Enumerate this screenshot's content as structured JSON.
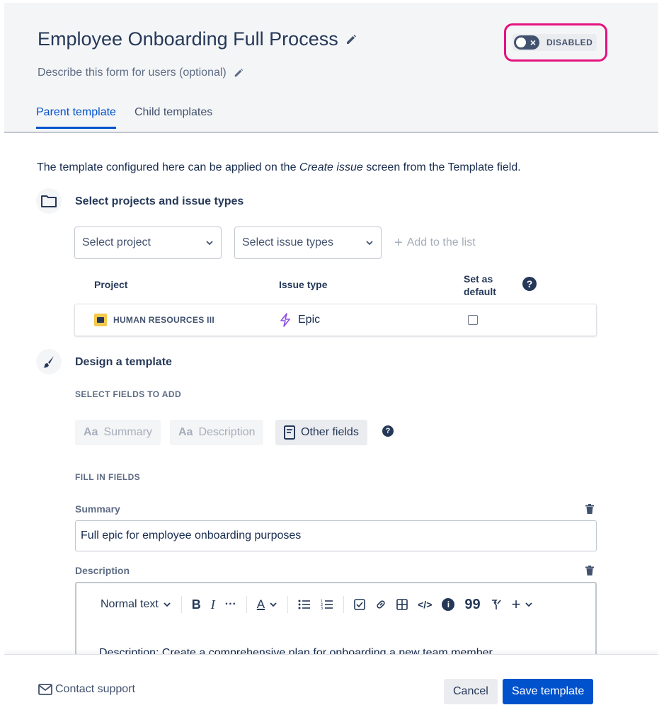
{
  "header": {
    "title": "Employee Onboarding Full Process",
    "subtitle": "Describe this form for users (optional)",
    "status_label": "DISABLED",
    "tabs": [
      {
        "label": "Parent template",
        "active": true
      },
      {
        "label": "Child templates",
        "active": false
      }
    ]
  },
  "intro": {
    "before": "The template configured here can be applied on the ",
    "emphasis": "Create issue",
    "after": " screen from the Template field."
  },
  "projects_section": {
    "title": "Select projects and issue types",
    "project_select_placeholder": "Select project",
    "issue_type_select_placeholder": "Select issue types",
    "add_to_list_label": "Add to the list",
    "table": {
      "col_project": "Project",
      "col_issue_type": "Issue type",
      "col_default_line1": "Set as",
      "col_default_line2": "default",
      "rows": [
        {
          "project": "HUMAN RESOURCES III",
          "issue_type": "Epic",
          "default": false
        }
      ]
    }
  },
  "design_section": {
    "title": "Design a template",
    "select_fields_label": "SELECT FIELDS TO ADD",
    "field_buttons": [
      {
        "icon": "Aa",
        "label": "Summary",
        "state": "disabled"
      },
      {
        "icon": "Aa",
        "label": "Description",
        "state": "disabled"
      },
      {
        "icon": "document-icon",
        "label": "Other fields",
        "state": "active"
      }
    ],
    "fill_in_label": "FILL IN FIELDS",
    "summary_label": "Summary",
    "summary_value": "Full epic for employee onboarding purposes",
    "description_label": "Description",
    "editor_text_style": "Normal text",
    "editor_content": "Description: Create a comprehensive plan for onboarding a new team member."
  },
  "footer": {
    "contact_label": "Contact support",
    "cancel_label": "Cancel",
    "save_label": "Save template"
  },
  "colors": {
    "primary": "#0052cc",
    "highlight": "#e5127d",
    "header_bg": "#f4f5f7"
  }
}
